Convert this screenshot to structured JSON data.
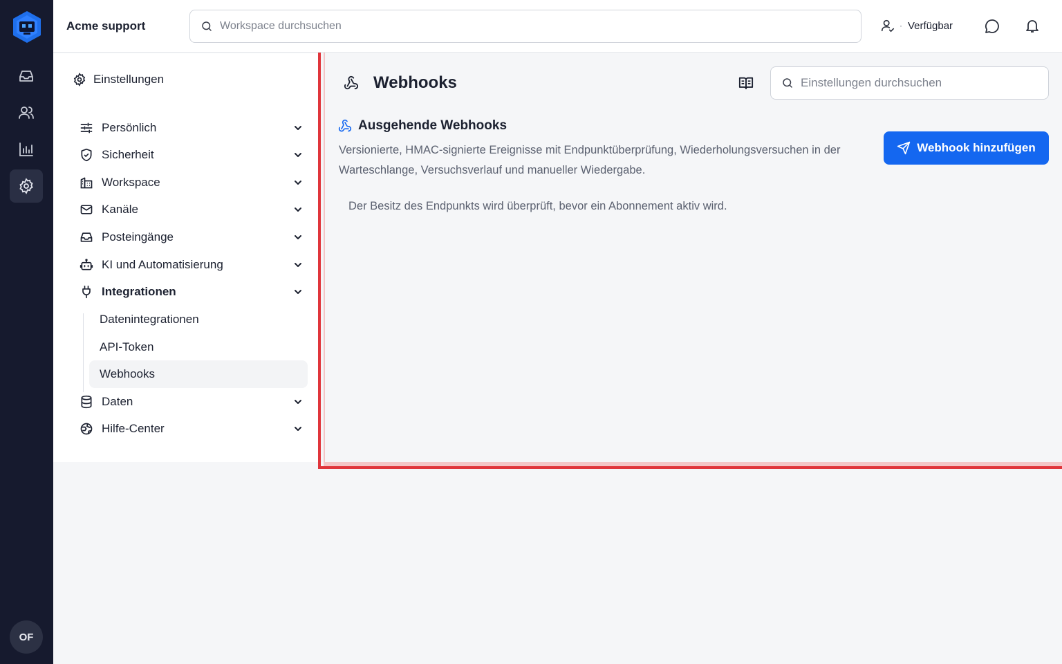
{
  "app": {
    "title": "Acme support",
    "user_initials": "OF"
  },
  "top_search": {
    "placeholder": "Workspace durchsuchen"
  },
  "status": {
    "separator": "·",
    "label": "Verfügbar"
  },
  "sidebar": {
    "header": "Einstellungen",
    "items": [
      {
        "label": "Persönlich",
        "icon": "sliders-icon"
      },
      {
        "label": "Sicherheit",
        "icon": "shield-icon"
      },
      {
        "label": "Workspace",
        "icon": "building-icon"
      },
      {
        "label": "Kanäle",
        "icon": "mail-icon"
      },
      {
        "label": "Posteingänge",
        "icon": "inbox-icon"
      },
      {
        "label": "KI und Automatisierung",
        "icon": "bot-icon"
      },
      {
        "label": "Integrationen",
        "icon": "plug-icon",
        "expanded": true
      },
      {
        "label": "Daten",
        "icon": "database-icon"
      },
      {
        "label": "Hilfe-Center",
        "icon": "globe-icon"
      }
    ],
    "subitems": [
      {
        "label": "Datenintegrationen"
      },
      {
        "label": "API-Token"
      },
      {
        "label": "Webhooks",
        "active": true
      }
    ]
  },
  "page": {
    "title": "Webhooks",
    "search_placeholder": "Einstellungen durchsuchen",
    "section_title": "Ausgehende Webhooks",
    "section_description": "Versionierte, HMAC-signierte Ereignisse mit Endpunktüberprüfung, Wiederholungsversuchen in der Warteschlange, Versuchsverlauf und manueller Wiedergabe.",
    "add_button": "Webhook hinzufügen",
    "note": "Der Besitz des Endpunkts wird überprüft, bevor ein Abonnement aktiv wird."
  },
  "colors": {
    "rail": "#161a2e",
    "accent": "#1467f0",
    "highlight_border": "#e0353b",
    "logo": "#1f6feb"
  }
}
